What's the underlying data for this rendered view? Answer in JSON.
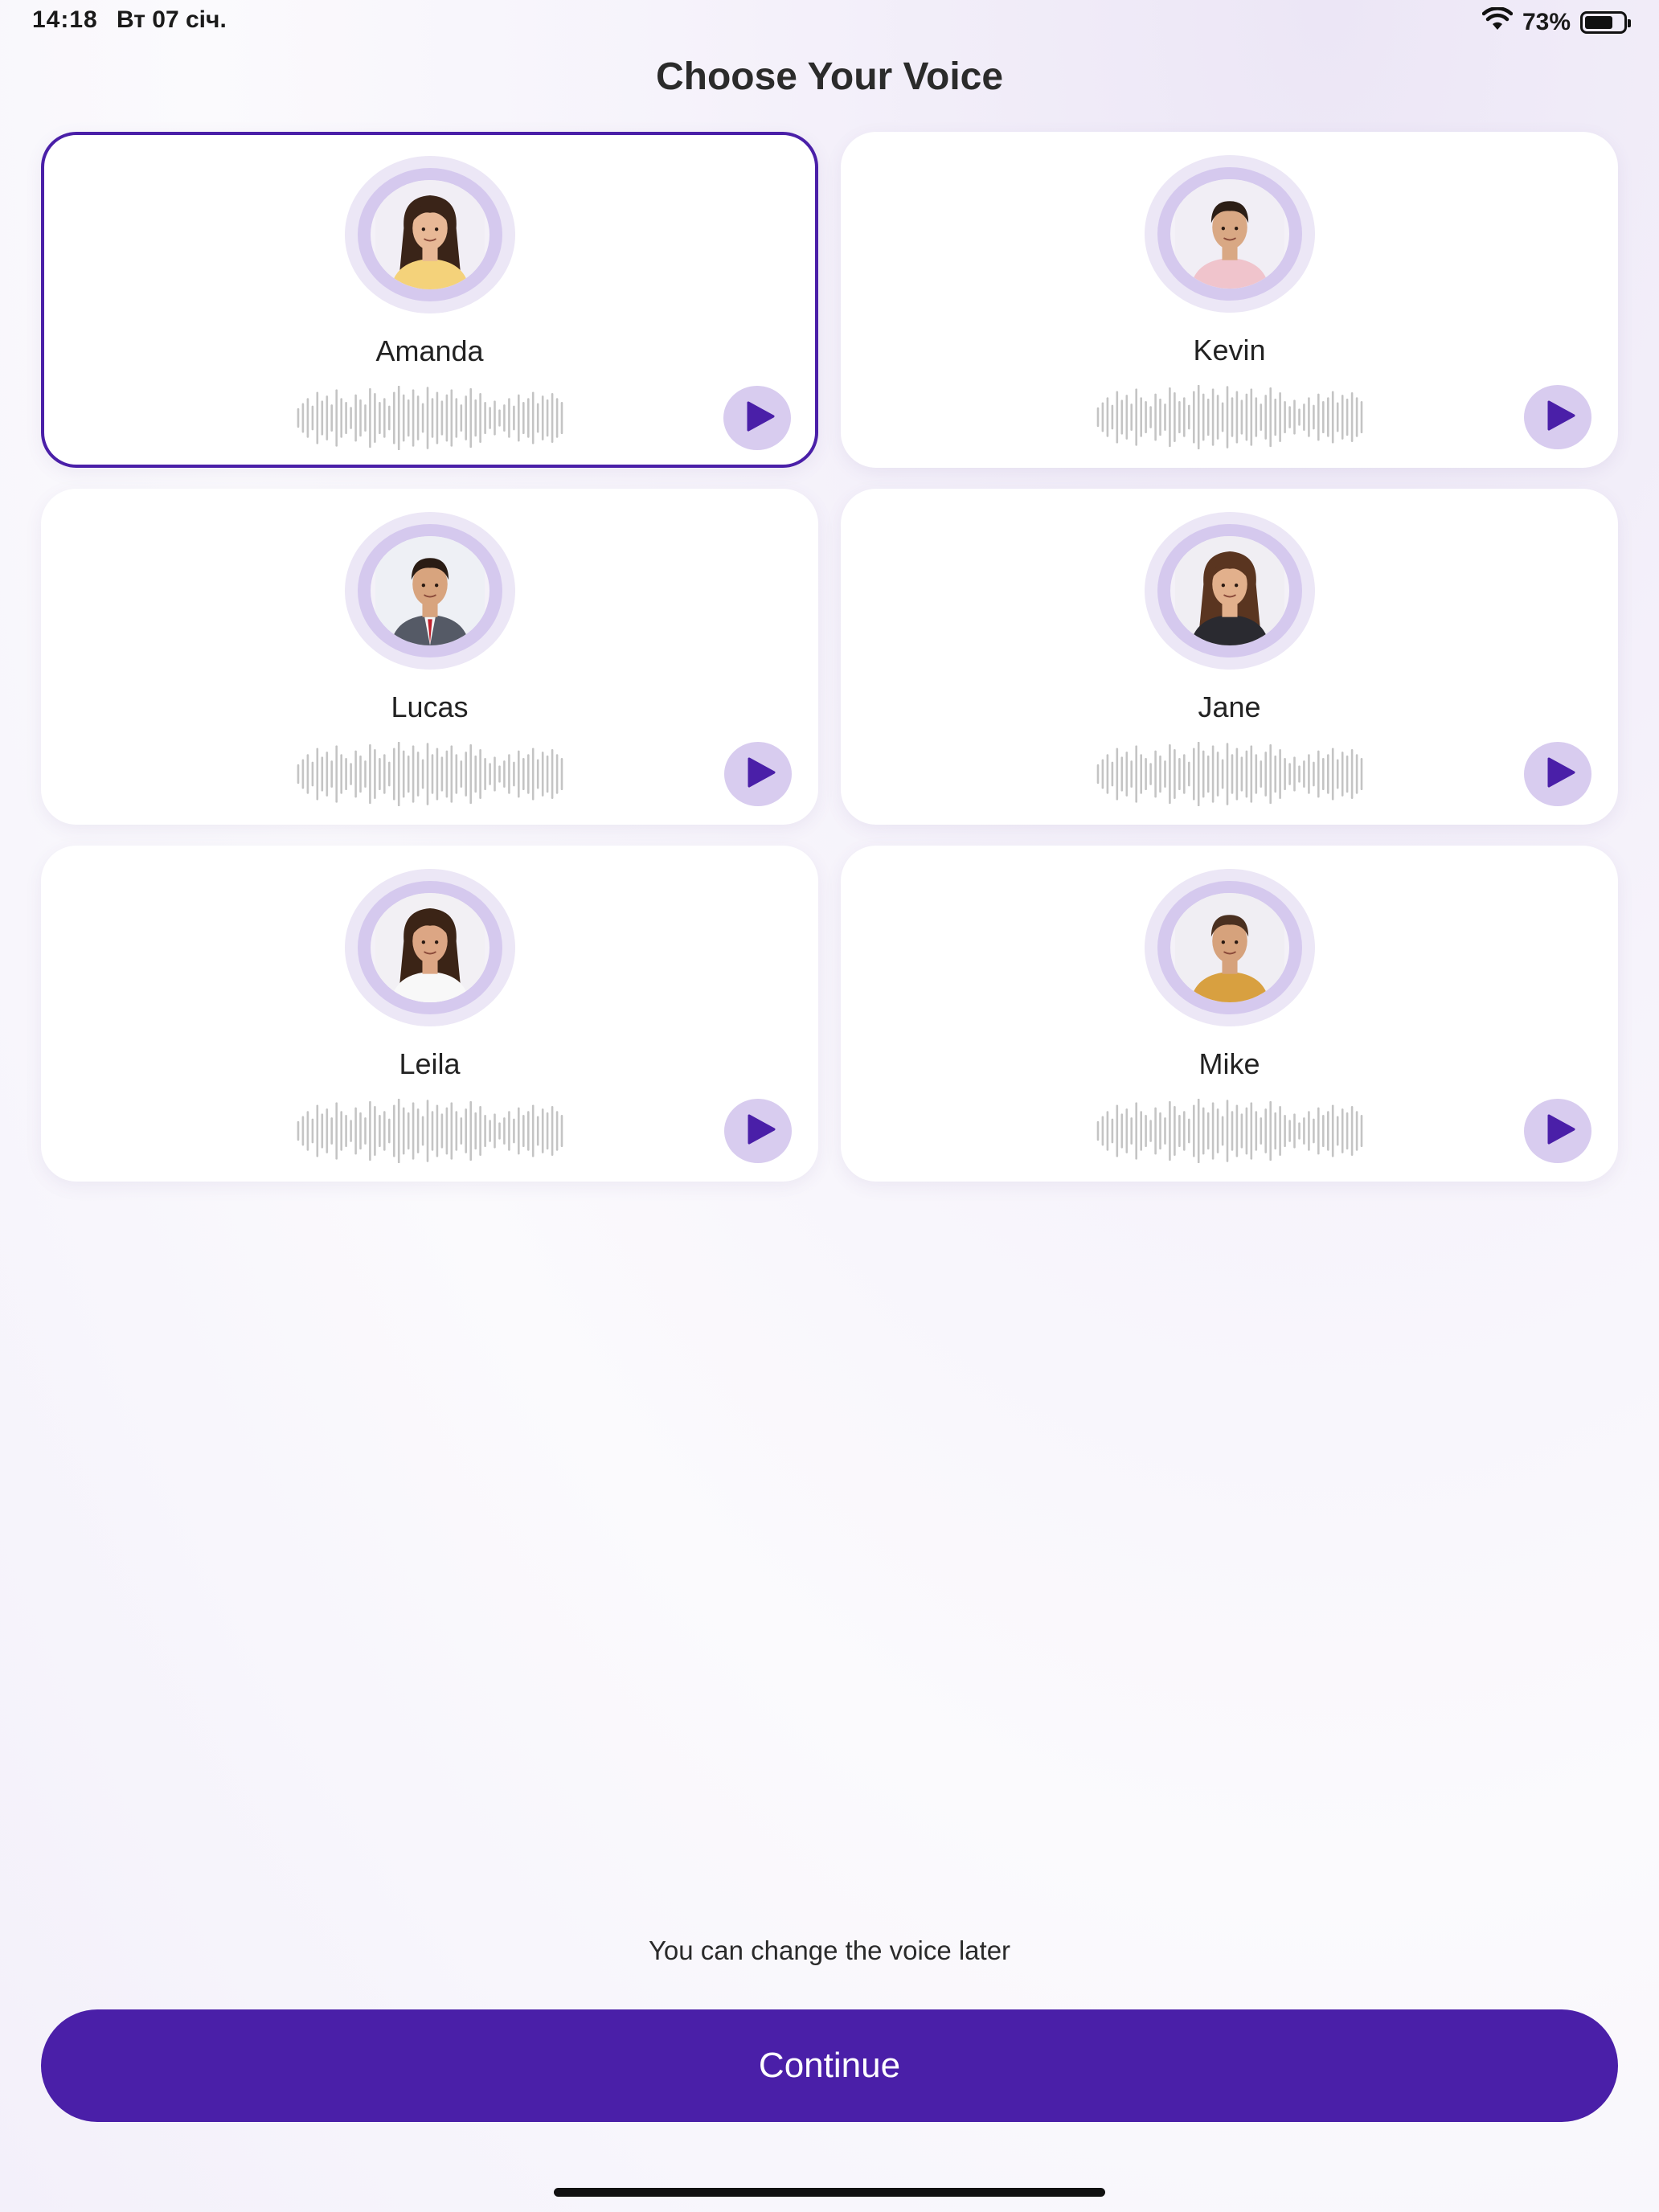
{
  "status_bar": {
    "time": "14:18",
    "date": "Вт 07 січ.",
    "battery_percent_label": "73%",
    "battery_level": 0.73,
    "wifi_icon": "wifi-icon",
    "battery_icon": "battery-icon"
  },
  "title": "Choose Your Voice",
  "accent_color": "#4a1fa8",
  "play_icon": "play-icon",
  "voices": [
    {
      "name": "Amanda",
      "selected": true,
      "avatar": "female-long-dark-hair"
    },
    {
      "name": "Kevin",
      "selected": false,
      "avatar": "male-short-dark-hair-pink-shirt"
    },
    {
      "name": "Lucas",
      "selected": false,
      "avatar": "male-suit-red-tie"
    },
    {
      "name": "Jane",
      "selected": false,
      "avatar": "female-curly-hair"
    },
    {
      "name": "Leila",
      "selected": false,
      "avatar": "female-wavy-hair-white-top"
    },
    {
      "name": "Mike",
      "selected": false,
      "avatar": "male-mustard-jacket"
    }
  ],
  "hint": "You can change the voice later",
  "continue_label": "Continue"
}
